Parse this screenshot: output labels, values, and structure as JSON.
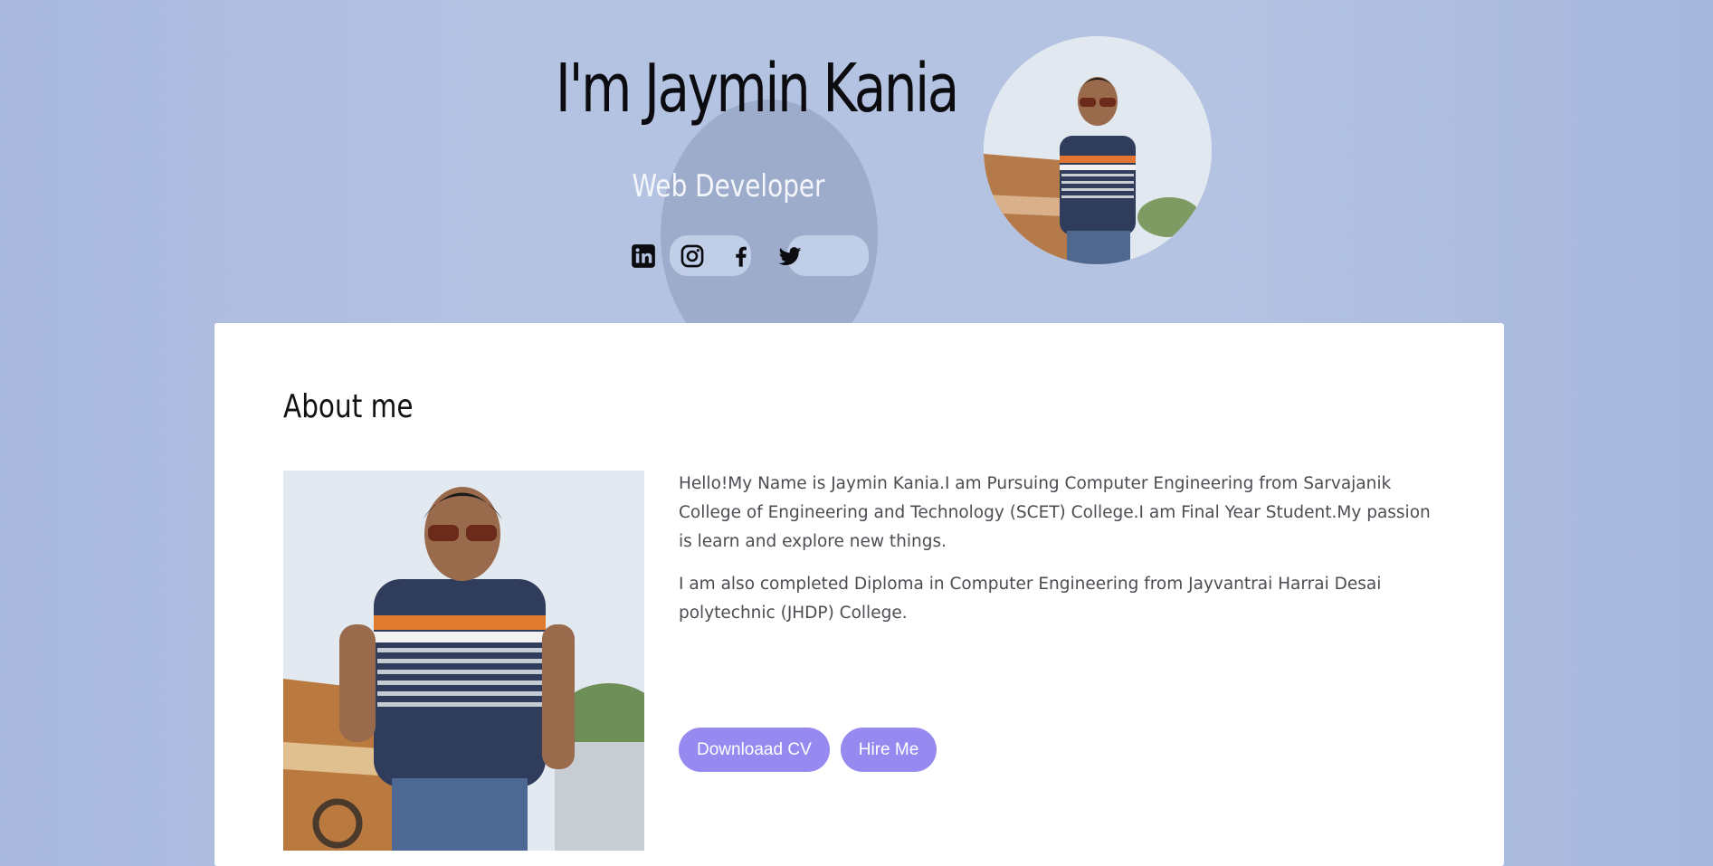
{
  "hero": {
    "title": "I'm Jaymin Kania",
    "subtitle": "Web Developer",
    "social_icons": [
      "linkedin-icon",
      "instagram-icon",
      "facebook-icon",
      "twitter-icon"
    ]
  },
  "about": {
    "heading": "About me",
    "paragraph_1": "Hello!My Name is Jaymin Kania.I am Pursuing Computer Engineering from Sarvajanik College of Engineering and Technology (SCET) College.I am Final Year Student.My passion is learn and explore new things.",
    "paragraph_2": "I am also completed Diploma in Computer Engineering from Jayvantrai Harrai Desai polytechnic (JHDP) College.",
    "download_cv_label": "Downloaad CV",
    "hire_me_label": "Hire Me"
  },
  "colors": {
    "background": "#b4c3e2",
    "button": "#9689f0",
    "card": "#ffffff"
  }
}
